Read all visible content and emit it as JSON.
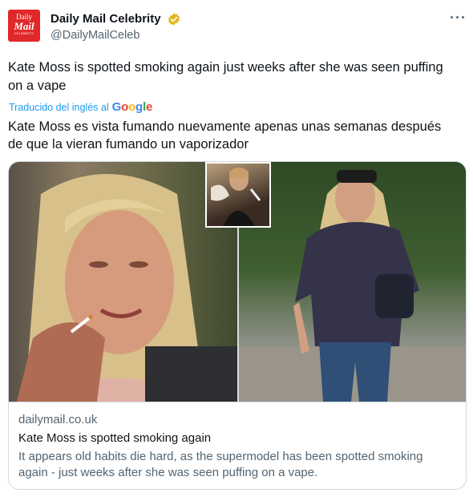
{
  "account": {
    "name": "Daily Mail Celebrity",
    "handle": "@DailyMailCeleb",
    "avatar_lines": [
      "Daily",
      "Mail",
      "CELEBRITY"
    ],
    "verified_color": "#e2b719"
  },
  "menu_icon": "more-horizontal-icon",
  "tweet": {
    "text": "Kate Moss is spotted smoking again just weeks after she was seen puffing on a vape",
    "translated_label": "Traducido del inglés al",
    "translation_provider": "Google",
    "translation": "Kate Moss es vista fumando nuevamente apenas unas semanas después de que la vieran fumando un vaporizador"
  },
  "card": {
    "domain": "dailymail.co.uk",
    "title": "Kate Moss is spotted smoking again",
    "description": "It appears old habits die hard, as the supermodel has been spotted smoking again - just weeks after she was seen puffing on a vape."
  },
  "colors": {
    "brand_red": "#e0282a",
    "link_blue": "#1d9bf0",
    "secondary_text": "#536471"
  }
}
